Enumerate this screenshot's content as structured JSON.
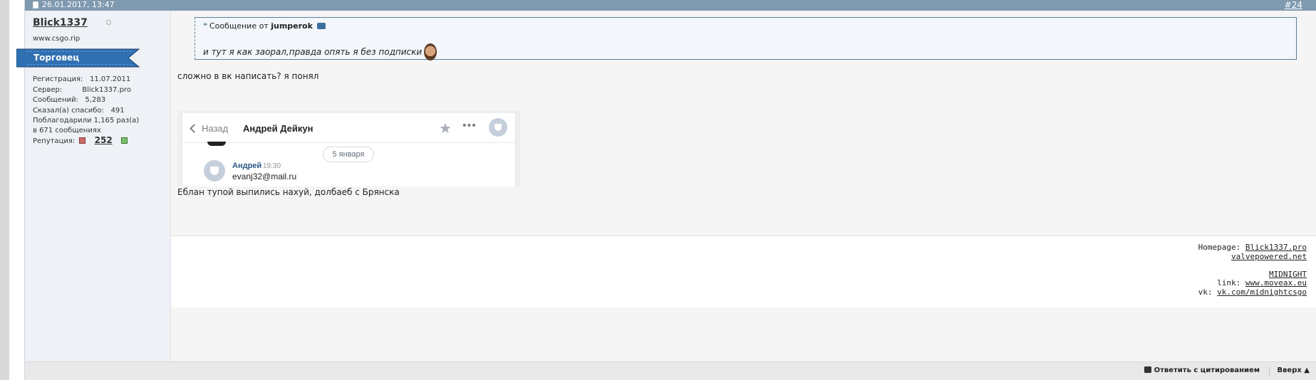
{
  "post": {
    "date": "26.01.2017, 13:47",
    "number": "#24"
  },
  "user": {
    "name": "Blick1337",
    "title": "www.csgo.rip",
    "rank": "Торговец",
    "stats": [
      {
        "label": "Регистрация:",
        "value": "11.07.2011"
      },
      {
        "label": "Сервер:",
        "value": "Blick1337.pro"
      },
      {
        "label": "Сообщений:",
        "value": "5,283"
      },
      {
        "label": "Сказал(а) спасибо:",
        "value": "491"
      }
    ],
    "thanked_line1": "Поблагодарили 1,165 раз(а)",
    "thanked_line2": "в 671 сообщениях",
    "rep_label": "Репутация:",
    "rep_value": "252"
  },
  "quote": {
    "prefix": "Сообщение от",
    "author": "jumperok",
    "text": "и тут я как заорал,правда опять я без подписки"
  },
  "message": {
    "line1": "сложно в вк написать? я понял",
    "line2": "Еблан тупой выпились нахуй, долбаеб с Брянска"
  },
  "vk": {
    "back_label": "Назад",
    "chat_name": "Андрей Дейкун",
    "date_pill": "5 января",
    "author": "Андрей",
    "time": "19:30",
    "email": "evanj32@mail.ru"
  },
  "signature": {
    "homepage_label": "Homepage:",
    "homepage_link": "Blick1337.pro",
    "second_link": "valvepowered.net",
    "midnight": "MIDNIGHT",
    "link_label": "link:",
    "link_value": "www.moveax.eu",
    "vk_label": "vk:",
    "vk_value": "vk.com/midnightcsgo"
  },
  "footer": {
    "reply_label": "Ответить с цитированием",
    "top_label": "Вверх ▲"
  },
  "colors": {
    "header": "#7f99af",
    "rank_ribbon": "#2f6fb2",
    "quote_border": "#5b7f98"
  }
}
